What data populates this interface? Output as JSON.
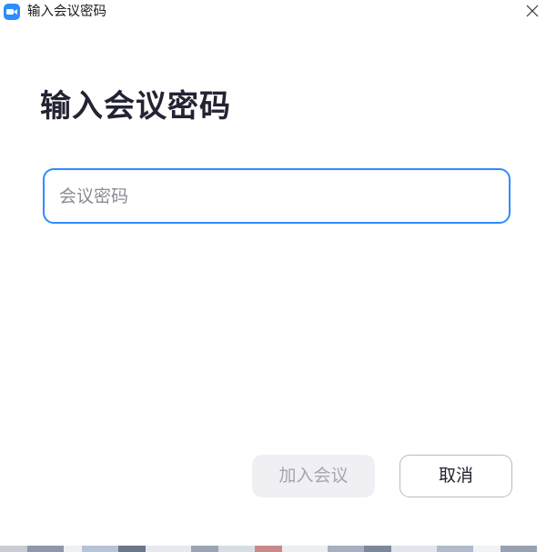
{
  "window": {
    "title": "输入会议密码",
    "app_icon": "zoom-camera-icon",
    "close_icon": "close-icon"
  },
  "main": {
    "heading": "输入会议密码",
    "password_placeholder": "会议密码",
    "password_value": ""
  },
  "buttons": {
    "join_label": "加入会议",
    "cancel_label": "取消"
  },
  "colors": {
    "accent": "#2d8cff",
    "heading": "#232333",
    "join_disabled_bg": "#f0f0f4",
    "join_disabled_text": "#a5a5b0",
    "cancel_border": "#b9b9c2"
  }
}
